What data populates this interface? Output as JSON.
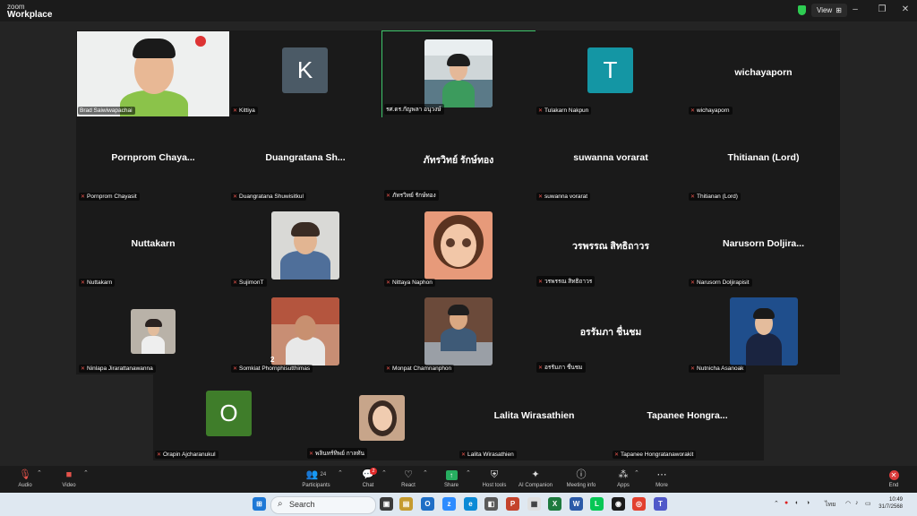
{
  "window": {
    "brand_small": "zoom",
    "brand_big": "Workplace",
    "view_label": "View",
    "view_icon": "⊞",
    "min_icon": "–",
    "max_icon": "❐",
    "close_icon": "✕"
  },
  "tiles": {
    "t1": {
      "name": "Brad Saiwiwapachai"
    },
    "t2": {
      "name": "Kittiya",
      "letter": "K"
    },
    "t3": {
      "name": "รศ.ดร.กัญพลา อนุวงษ์"
    },
    "t4": {
      "name": "Tulakarn Nakpun",
      "letter": "T"
    },
    "t5": {
      "name": "wichayaporn",
      "big": "wichayaporn"
    },
    "t6": {
      "name": "Pornprom Chayasit",
      "big": "Pornprom  Chaya..."
    },
    "t7": {
      "name": "Duangratana Shuwisitkul",
      "big": "Duangratana  Sh..."
    },
    "t8": {
      "name": "ภัทรวิทย์ รักษ์ทอง",
      "big": "ภัทรวิทย์ รักษ์ทอง"
    },
    "t9": {
      "name": "suwanna vorarat",
      "big": "suwanna vorarat"
    },
    "t10": {
      "name": "Thitianan (Lord)",
      "big": "Thitianan (Lord)"
    },
    "t11": {
      "name": "Nuttakarn",
      "big": "Nuttakarn"
    },
    "t12": {
      "name": "SujimonT"
    },
    "t13": {
      "name": "Nittaya Naphon"
    },
    "t14": {
      "name": "วรพรรณ สิทธิถาวร",
      "big": "วรพรรณ สิทธิถาวร"
    },
    "t15": {
      "name": "Narusorn Doljirapisit",
      "big": "Narusorn  Doljira..."
    },
    "t16": {
      "name": "Ninlapa Jirarattanawanna"
    },
    "t17": {
      "name": "Somkiat Phornphisutthimas",
      "number": "2"
    },
    "t18": {
      "name": "Monpat Chamnanphon"
    },
    "t19": {
      "name": "อรรัมภา ชื่นชม",
      "big": "อรรัมภา ชื่นชม"
    },
    "t20": {
      "name": "Nutnicha Asanoak"
    },
    "t21": {
      "name": "Orapin Ajcharanukul",
      "letter": "O"
    },
    "t22": {
      "name": "พลินทร์ทิพย์ กาลทัน"
    },
    "t23": {
      "name": "Lalita Wirasathien",
      "big": "Lalita Wirasathien"
    },
    "t24": {
      "name": "Tapanee Hongratanaworakit",
      "big": "Tapanee  Hongra..."
    }
  },
  "colors": {
    "avatar_k": "#4b5a66",
    "avatar_t": "#1496a4",
    "avatar_o": "#3f7d2a",
    "active_border": "#3ec66b"
  },
  "toolbar": {
    "audio": "Audio",
    "video": "Video",
    "participants": "Participants",
    "participants_count": "24",
    "chat": "Chat",
    "chat_badge": "2",
    "react": "React",
    "share": "Share",
    "host_tools": "Host tools",
    "ai_companion": "AI Companion",
    "meeting_info": "Meeting info",
    "apps": "Apps",
    "more": "More",
    "end": "End"
  },
  "taskbar": {
    "search_placeholder": "Search",
    "time": "10:49",
    "date": "31/7/2568",
    "lang": "ไทย"
  }
}
